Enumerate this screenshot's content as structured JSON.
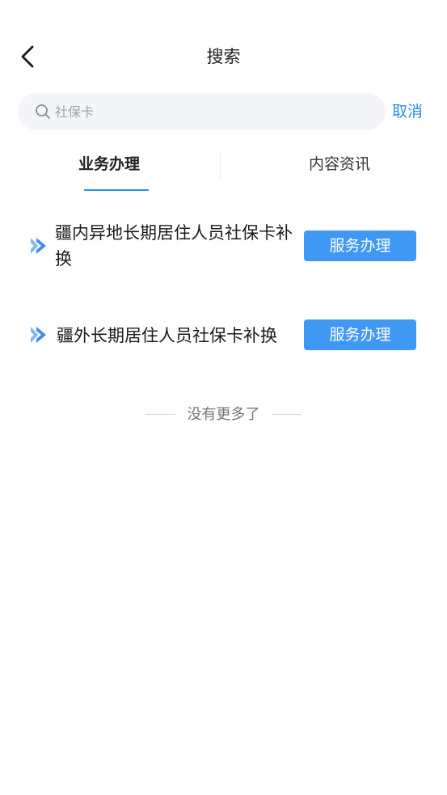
{
  "header": {
    "title": "搜索"
  },
  "search": {
    "placeholder": "社保卡",
    "value": "",
    "cancel_label": "取消"
  },
  "tabs": [
    {
      "label": "业务办理",
      "active": true
    },
    {
      "label": "内容资讯",
      "active": false
    }
  ],
  "services": [
    {
      "title": "疆内异地长期居住人员社保卡补换",
      "button_label": "服务办理"
    },
    {
      "title": "疆外长期居住人员社保卡补换",
      "button_label": "服务办理"
    }
  ],
  "list_end_text": "没有更多了",
  "colors": {
    "accent": "#2b8ee6",
    "button": "#4098f5",
    "search_bg": "#f4f5f8"
  },
  "icons": [
    "back-arrow-icon",
    "search-icon",
    "double-chevron-right-icon"
  ]
}
